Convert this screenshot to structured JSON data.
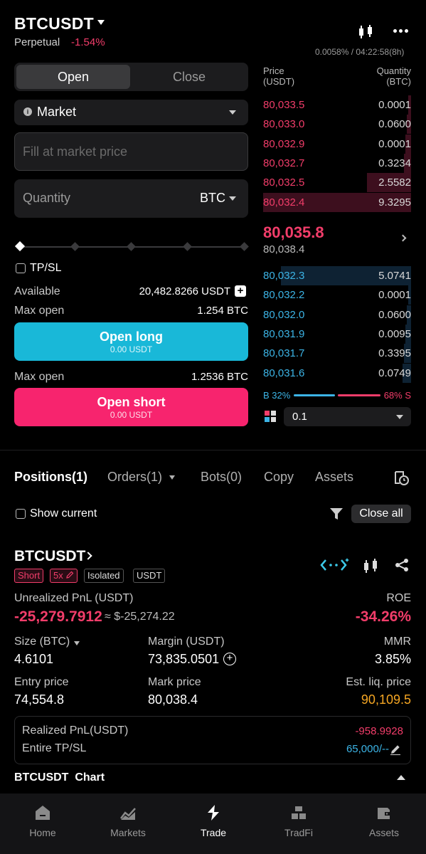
{
  "header": {
    "symbol": "BTCUSDT",
    "contract_type": "Perpetual",
    "change": "-1.54%"
  },
  "form": {
    "tabs": [
      "Open",
      "Close"
    ],
    "order_type": "Market",
    "price_placeholder": "Fill at market price",
    "quantity_label": "Quantity",
    "quantity_unit": "BTC",
    "slider_position": 0,
    "tpsl_label": "TP/SL",
    "tpsl_checked": false,
    "available_label": "Available",
    "available_value": "20,482.8266 USDT",
    "max_open_label": "Max open",
    "max_open_long": "1.254 BTC",
    "max_open_short": "1.2536 BTC",
    "long_button": "Open long",
    "long_sub": "0.00 USDT",
    "short_button": "Open short",
    "short_sub": "0.00 USDT"
  },
  "orderbook": {
    "cut_text": "0.0058% / 04:22:58(8h)",
    "price_header": [
      "Price",
      "(USDT)"
    ],
    "qty_header": [
      "Quantity",
      "(BTC)"
    ],
    "asks": [
      {
        "price": "80,033.5",
        "qty": "0.0001",
        "depth": 0.02
      },
      {
        "price": "80,033.0",
        "qty": "0.0600",
        "depth": 0.03
      },
      {
        "price": "80,032.9",
        "qty": "0.0001",
        "depth": 0.04
      },
      {
        "price": "80,032.7",
        "qty": "0.3234",
        "depth": 0.05
      },
      {
        "price": "80,032.5",
        "qty": "2.5582",
        "depth": 0.3
      },
      {
        "price": "80,032.4",
        "qty": "9.3295",
        "depth": 1.0
      }
    ],
    "last_price": "80,035.8",
    "mark_price": "80,038.4",
    "bids": [
      {
        "price": "80,032.3",
        "qty": "5.0741",
        "depth": 0.88
      },
      {
        "price": "80,032.2",
        "qty": "0.0001",
        "depth": 0.02
      },
      {
        "price": "80,032.0",
        "qty": "0.0600",
        "depth": 0.03
      },
      {
        "price": "80,031.9",
        "qty": "0.0095",
        "depth": 0.04
      },
      {
        "price": "80,031.7",
        "qty": "0.3395",
        "depth": 0.05
      },
      {
        "price": "80,031.6",
        "qty": "0.0749",
        "depth": 0.06
      }
    ],
    "buy_ratio": "B 32%",
    "sell_ratio": "68% S",
    "depth_step": "0.1",
    "colors": {
      "ask": "#f23d6a",
      "bid": "#3cb4e6",
      "ask_bar": "#3d0f1e",
      "bid_bar": "#0e2233"
    }
  },
  "tabs": {
    "positions": "Positions(1)",
    "orders": "Orders(1)",
    "bots": "Bots(0)",
    "copy": "Copy",
    "assets": "Assets"
  },
  "filter": {
    "show_current": "Show current",
    "close_all": "Close all"
  },
  "position": {
    "symbol": "BTCUSDT",
    "side": "Short",
    "leverage": "5x",
    "margin_mode": "Isolated",
    "settle": "USDT",
    "upnl_label": "Unrealized PnL (USDT)",
    "upnl_value": "-25,279.7912",
    "upnl_approx": "≈ $-25,274.22",
    "roe_label": "ROE",
    "roe_value": "-34.26%",
    "size_label": "Size (BTC)",
    "size_value": "4.6101",
    "margin_label": "Margin (USDT)",
    "margin_value": "73,835.0501",
    "mmr_label": "MMR",
    "mmr_value": "3.85%",
    "entry_label": "Entry price",
    "entry_value": "74,554.8",
    "mark_label": "Mark price",
    "mark_value": "80,038.4",
    "liq_label": "Est. liq. price",
    "liq_value": "90,109.5",
    "rpnl_label": "Realized PnL(USDT)",
    "rpnl_value": "-958.9928",
    "tpsl_label": "Entire TP/SL",
    "tpsl_value": "65,000/--"
  },
  "chart_toggle": "BTCUSDT  Chart",
  "nav": [
    {
      "label": "Home",
      "icon": "home-icon"
    },
    {
      "label": "Markets",
      "icon": "markets-icon"
    },
    {
      "label": "Trade",
      "icon": "trade-icon",
      "active": true
    },
    {
      "label": "TradFi",
      "icon": "tradfi-icon"
    },
    {
      "label": "Assets",
      "icon": "assets-icon"
    }
  ]
}
